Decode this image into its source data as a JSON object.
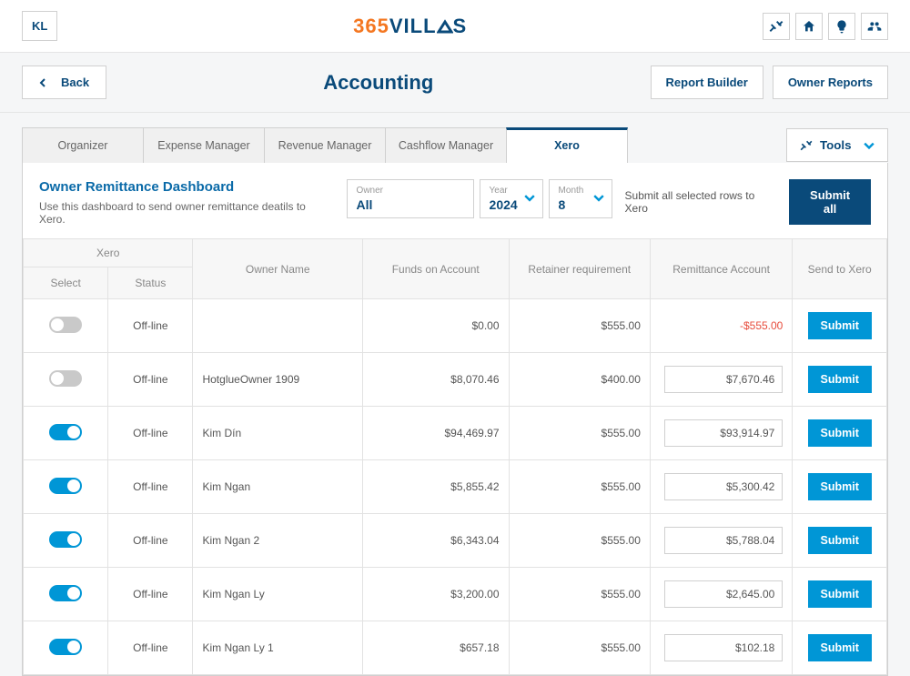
{
  "header": {
    "avatar": "KL",
    "logo_365": "365",
    "logo_villas": "VILL",
    "logo_s": "S"
  },
  "subheader": {
    "back": "Back",
    "title": "Accounting",
    "report_builder": "Report Builder",
    "owner_reports": "Owner Reports"
  },
  "tabs": {
    "organizer": "Organizer",
    "expense": "Expense Manager",
    "revenue": "Revenue Manager",
    "cashflow": "Cashflow Manager",
    "xero": "Xero",
    "tools": "Tools"
  },
  "panel": {
    "title": "Owner Remittance Dashboard",
    "desc": "Use this dashboard to send owner remittance deatils to Xero.",
    "filter_owner_label": "Owner",
    "filter_owner_value": "All",
    "filter_year_label": "Year",
    "filter_year_value": "2024",
    "filter_month_label": "Month",
    "filter_month_value": "8",
    "submit_text": "Submit all selected rows to Xero",
    "submit_all": "Submit all"
  },
  "table": {
    "headers": {
      "xero_group": "Xero",
      "select": "Select",
      "status": "Status",
      "owner": "Owner Name",
      "funds": "Funds on Account",
      "retainer": "Retainer requirement",
      "remit": "Remittance Account",
      "send": "Send to Xero"
    },
    "submit_label": "Submit",
    "rows": [
      {
        "selected": false,
        "status": "Off-line",
        "owner": "",
        "funds": "$0.00",
        "retainer": "$555.00",
        "remit": "-$555.00",
        "remit_neg": true,
        "remit_input": false
      },
      {
        "selected": false,
        "status": "Off-line",
        "owner": "HotglueOwner 1909",
        "funds": "$8,070.46",
        "retainer": "$400.00",
        "remit": "$7,670.46",
        "remit_neg": false,
        "remit_input": true
      },
      {
        "selected": true,
        "status": "Off-line",
        "owner": "Kim Dín",
        "funds": "$94,469.97",
        "retainer": "$555.00",
        "remit": "$93,914.97",
        "remit_neg": false,
        "remit_input": true
      },
      {
        "selected": true,
        "status": "Off-line",
        "owner": "Kim Ngan",
        "funds": "$5,855.42",
        "retainer": "$555.00",
        "remit": "$5,300.42",
        "remit_neg": false,
        "remit_input": true
      },
      {
        "selected": true,
        "status": "Off-line",
        "owner": "Kim Ngan 2",
        "funds": "$6,343.04",
        "retainer": "$555.00",
        "remit": "$5,788.04",
        "remit_neg": false,
        "remit_input": true
      },
      {
        "selected": true,
        "status": "Off-line",
        "owner": "Kim Ngan Ly",
        "funds": "$3,200.00",
        "retainer": "$555.00",
        "remit": "$2,645.00",
        "remit_neg": false,
        "remit_input": true
      },
      {
        "selected": true,
        "status": "Off-line",
        "owner": "Kim Ngan Ly 1",
        "funds": "$657.18",
        "retainer": "$555.00",
        "remit": "$102.18",
        "remit_neg": false,
        "remit_input": true
      }
    ]
  }
}
